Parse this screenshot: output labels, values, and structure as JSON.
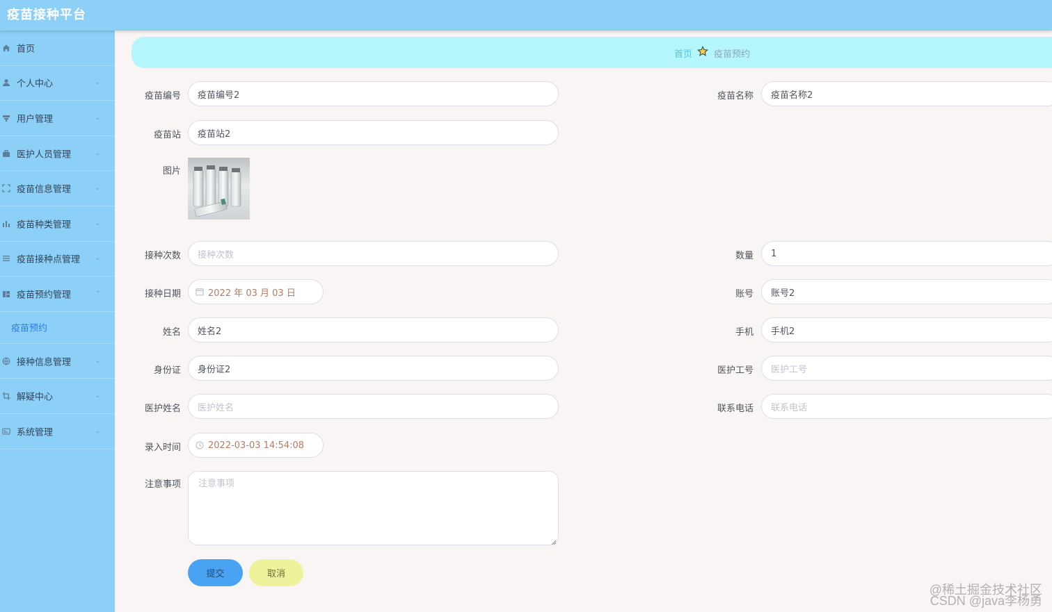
{
  "app": {
    "title": "疫苗接种平台"
  },
  "sidebar": {
    "items": [
      {
        "label": "首页",
        "icon": "home-icon"
      },
      {
        "label": "个人中心",
        "icon": "user-icon",
        "chevron": "down"
      },
      {
        "label": "用户管理",
        "icon": "user-manage-icon",
        "chevron": "down"
      },
      {
        "label": "医护人员管理",
        "icon": "briefcase-icon",
        "chevron": "down"
      },
      {
        "label": "疫苗信息管理",
        "icon": "frame-icon",
        "chevron": "down"
      },
      {
        "label": "疫苗种类管理",
        "icon": "bar-chart-icon",
        "chevron": "down"
      },
      {
        "label": "疫苗接种点管理",
        "icon": "list-icon",
        "chevron": "down"
      },
      {
        "label": "疫苗预约管理",
        "icon": "grid-icon",
        "chevron": "up",
        "expanded": true,
        "children": [
          {
            "label": "疫苗预约"
          }
        ]
      },
      {
        "label": "接种信息管理",
        "icon": "globe-icon",
        "chevron": "down"
      },
      {
        "label": "解疑中心",
        "icon": "crop-icon",
        "chevron": "down"
      },
      {
        "label": "系统管理",
        "icon": "card-icon",
        "chevron": "down"
      }
    ]
  },
  "breadcrumb": {
    "home": "首页",
    "current": "疫苗预约",
    "separator_icon": "star-icon"
  },
  "form": {
    "vaccine_no": {
      "label": "疫苗编号",
      "value": "疫苗编号2"
    },
    "vaccine_name": {
      "label": "疫苗名称",
      "value": "疫苗名称2"
    },
    "station": {
      "label": "疫苗站",
      "value": "疫苗站2"
    },
    "picture": {
      "label": "图片"
    },
    "dose_count": {
      "label": "接种次数",
      "value": "",
      "placeholder": "接种次数"
    },
    "quantity": {
      "label": "数量",
      "value": "1"
    },
    "date": {
      "label": "接种日期",
      "value": "2022 年 03 月 03 日"
    },
    "account": {
      "label": "账号",
      "value": "账号2"
    },
    "name": {
      "label": "姓名",
      "value": "姓名2"
    },
    "phone": {
      "label": "手机",
      "value": "手机2"
    },
    "id_card": {
      "label": "身份证",
      "value": "身份证2"
    },
    "staff_no": {
      "label": "医护工号",
      "value": "",
      "placeholder": "医护工号"
    },
    "staff_name": {
      "label": "医护姓名",
      "value": "",
      "placeholder": "医护姓名"
    },
    "contact_phone": {
      "label": "联系电话",
      "value": "",
      "placeholder": "联系电话"
    },
    "entry_time": {
      "label": "录入时间",
      "value": "2022-03-03 14:54:08"
    },
    "notes": {
      "label": "注意事项",
      "value": "",
      "placeholder": "注意事项"
    },
    "submit_label": "提交",
    "cancel_label": "取消"
  },
  "watermark": {
    "line1": "@稀土掘金技术社区",
    "line2": "CSDN @java李杨勇"
  },
  "colors": {
    "topbar": "#8ccff7",
    "sidebar": "#8ccff7",
    "breadcrumb": "#b5f5fc",
    "submit": "#4aa3f2",
    "cancel": "#eef39b",
    "page": "#f8f5f4"
  }
}
